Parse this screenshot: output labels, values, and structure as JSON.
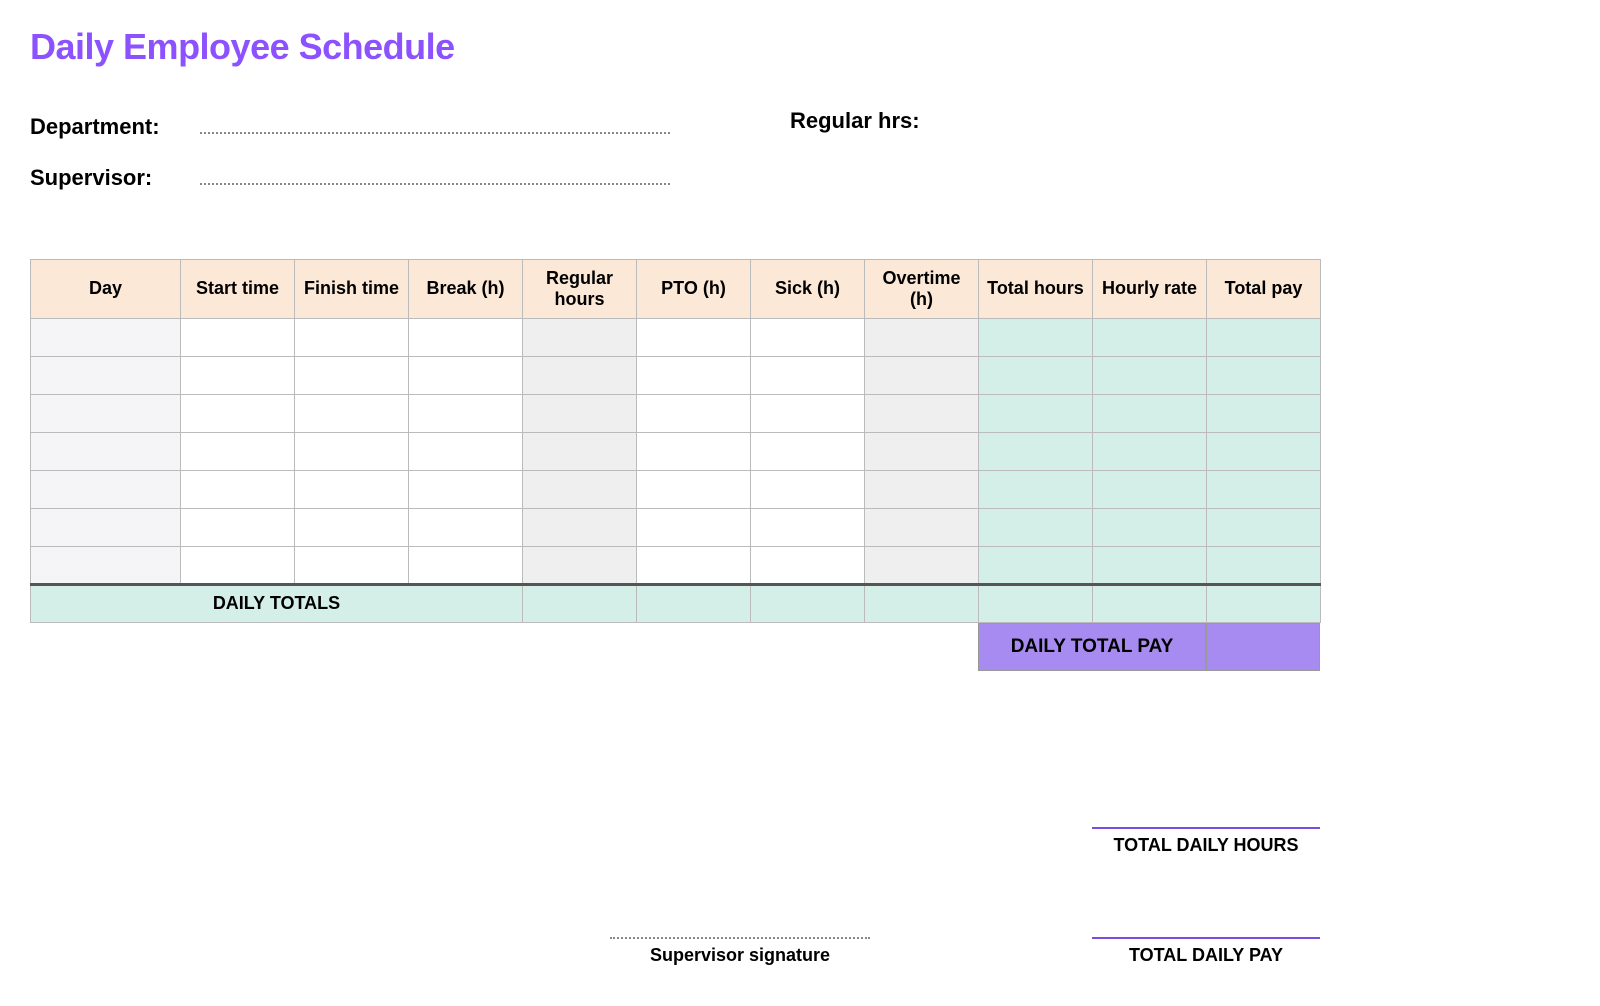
{
  "title": "Daily Employee Schedule",
  "meta": {
    "department_label": "Department:",
    "supervisor_label": "Supervisor:",
    "regular_hrs_label": "Regular hrs:",
    "department_value": "",
    "supervisor_value": "",
    "regular_hrs_value": ""
  },
  "table": {
    "headers": [
      "Day",
      "Start time",
      "Finish time",
      "Break (h)",
      "Regular hours",
      "PTO (h)",
      "Sick (h)",
      "Overtime (h)",
      "Total hours",
      "Hourly rate",
      "Total pay"
    ],
    "row_count": 7
  },
  "totals": {
    "daily_totals_label": "DAILY TOTALS",
    "daily_total_pay_label": "DAILY TOTAL PAY",
    "daily_total_pay_value": ""
  },
  "footer": {
    "supervisor_signature_label": "Supervisor signature",
    "total_daily_hours_label": "TOTAL DAILY HOURS",
    "total_daily_pay_label": "TOTAL DAILY PAY"
  }
}
